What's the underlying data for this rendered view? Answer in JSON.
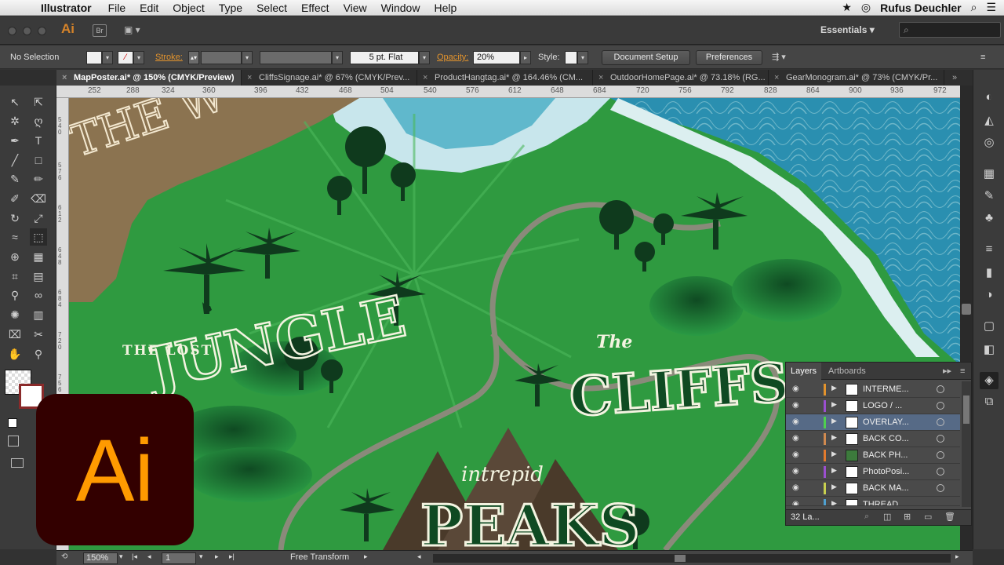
{
  "menubar": {
    "app": "Illustrator",
    "items": [
      "File",
      "Edit",
      "Object",
      "Type",
      "Select",
      "Effect",
      "View",
      "Window",
      "Help"
    ],
    "user": "Rufus Deuchler"
  },
  "appbar": {
    "app_icon": "Ai",
    "bridge_label": "Br",
    "workspace": "Essentials"
  },
  "control": {
    "selection": "No Selection",
    "stroke_label": "Stroke:",
    "brush": "5 pt. Flat",
    "opacity_label": "Opacity:",
    "opacity_value": "20%",
    "style_label": "Style:",
    "document_setup": "Document Setup",
    "preferences": "Preferences"
  },
  "tabs": [
    "MapPoster.ai* @ 150% (CMYK/Preview)",
    "CliffsSignage.ai* @ 67% (CMYK/Prev...",
    "ProductHangtag.ai* @ 164.46% (CM...",
    "OutdoorHomePage.ai* @ 73.18% (RG...",
    "GearMonogram.ai* @ 73% (CMYK/Pr..."
  ],
  "ruler_top": [
    "252",
    "288",
    "324",
    "360",
    "396",
    "432",
    "468",
    "504",
    "540",
    "576",
    "612",
    "648",
    "684",
    "720",
    "756",
    "792",
    "828",
    "864",
    "900",
    "936",
    "972"
  ],
  "ruler_left": [
    "540",
    "576",
    "612",
    "648",
    "684",
    "720",
    "756"
  ],
  "artwork": {
    "jungle_small": "THE LOST",
    "jungle": "JUNGLE",
    "cliffs_the": "The",
    "cliffs": "CLIFFS",
    "peaks_small": "intrepid",
    "peaks": "PEAKS",
    "banner": "THE W"
  },
  "layers": {
    "tab_layers": "Layers",
    "tab_artboards": "Artboards",
    "rows": [
      {
        "name": "INTERME...",
        "color": "#e2932d"
      },
      {
        "name": "LOGO / ...",
        "color": "#9b4fd0"
      },
      {
        "name": "OVERLAY...",
        "color": "#4fd04f"
      },
      {
        "name": "BACK CO...",
        "color": "#d08a4f"
      },
      {
        "name": "BACK PH...",
        "color": "#e27a2d"
      },
      {
        "name": "PhotoPosi...",
        "color": "#9b4fd0"
      },
      {
        "name": "BACK MA...",
        "color": "#c8d04f"
      },
      {
        "name": "THREAD",
        "color": "#4fa0d0"
      }
    ],
    "count": "32 La..."
  },
  "status": {
    "zoom": "150%",
    "artboard": "1",
    "tool": "Free Transform"
  },
  "logo": "Ai"
}
